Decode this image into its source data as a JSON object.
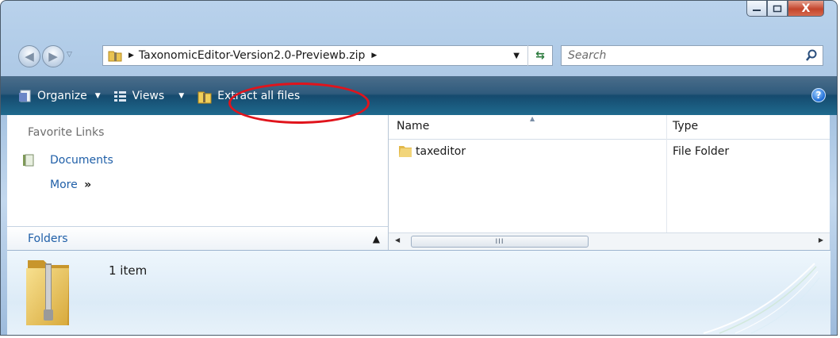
{
  "window": {
    "caption_buttons": {
      "minimize": "minimize",
      "maximize": "maximize",
      "close": "X"
    }
  },
  "address": {
    "path_item": "TaxonomicEditor-Version2.0-Previewb.zip",
    "search_placeholder": "Search"
  },
  "toolbar": {
    "organize_label": "Organize",
    "views_label": "Views",
    "extract_label": "Extract all files",
    "help_glyph": "?"
  },
  "navigation_pane": {
    "favorite_links_title": "Favorite Links",
    "documents_label": "Documents",
    "more_label": "More",
    "folders_label": "Folders"
  },
  "file_list": {
    "columns": [
      "Name",
      "Type"
    ],
    "rows": [
      {
        "name": "taxeditor",
        "type": "File Folder"
      }
    ],
    "scroll_grip": "III"
  },
  "details_pane": {
    "item_count": "1 item"
  },
  "colors": {
    "toolbar": "#1f5a7e",
    "link": "#1f5fa8",
    "annotation": "#e0141c"
  }
}
